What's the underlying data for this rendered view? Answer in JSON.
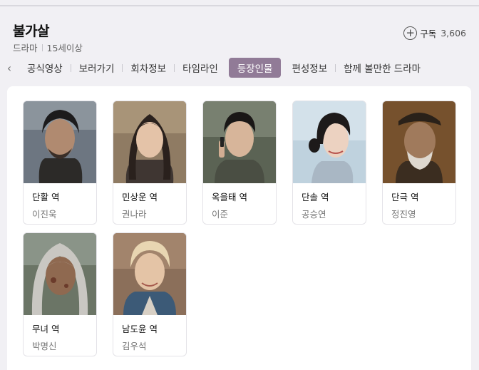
{
  "header": {
    "title": "불가살",
    "genre": "드라마",
    "rating": "15세이상",
    "subscribe_label": "구독",
    "subscribe_count": "3,606"
  },
  "tabs": [
    {
      "label": "공식영상"
    },
    {
      "label": "보러가기"
    },
    {
      "label": "회차정보"
    },
    {
      "label": "타임라인"
    },
    {
      "label": "등장인물",
      "active": true
    },
    {
      "label": "편성정보"
    },
    {
      "label": "함께 볼만한 드라마"
    }
  ],
  "cast": [
    {
      "role": "단활 역",
      "actor": "이진욱"
    },
    {
      "role": "민상운 역",
      "actor": "권나라"
    },
    {
      "role": "옥을태 역",
      "actor": "이준"
    },
    {
      "role": "단솔 역",
      "actor": "공승연"
    },
    {
      "role": "단극 역",
      "actor": "정진영"
    },
    {
      "role": "무녀 역",
      "actor": "박명신"
    },
    {
      "role": "남도윤 역",
      "actor": "김우석"
    }
  ]
}
